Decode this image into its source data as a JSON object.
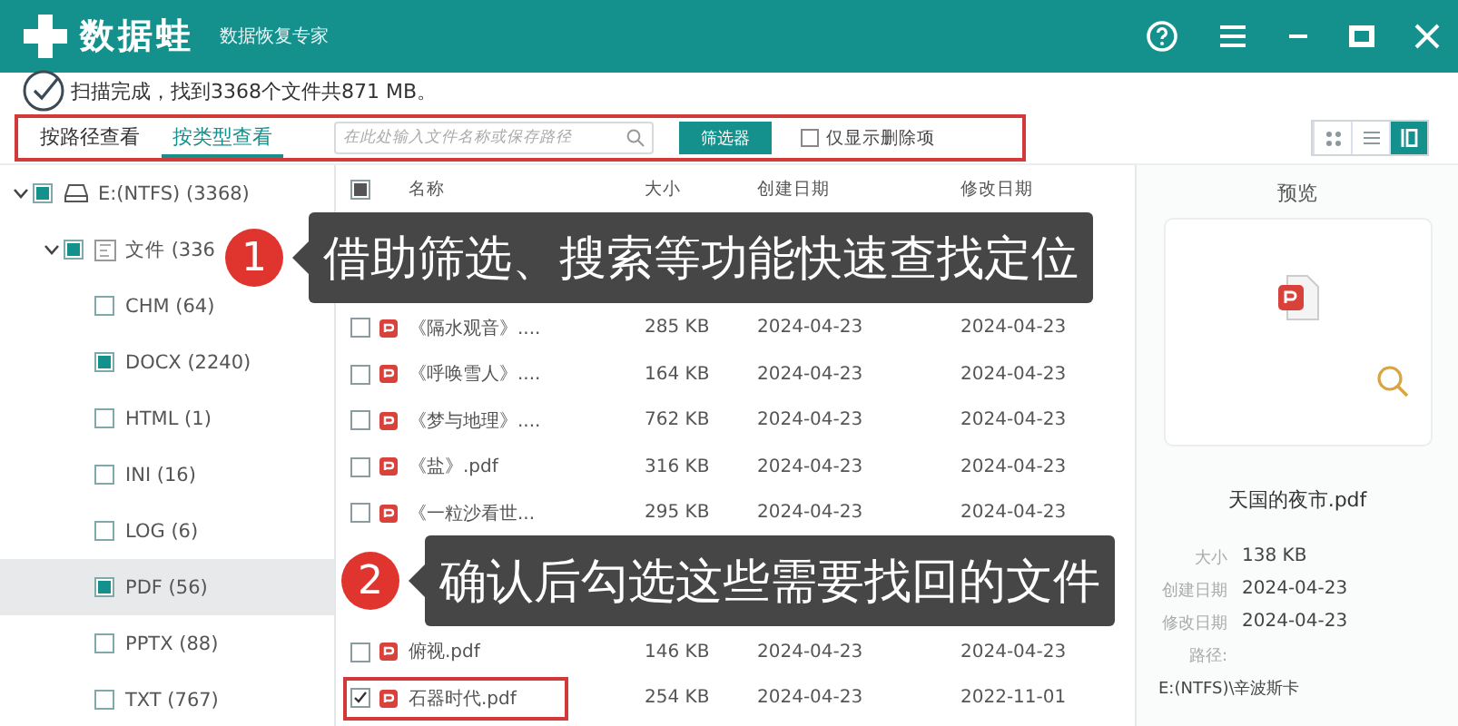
{
  "window": {
    "title": "数据蛙",
    "subtitle": "数据恢复专家"
  },
  "status": {
    "text": "扫描完成，找到3368个文件共871 MB。"
  },
  "toolbar": {
    "highlighted": true,
    "tabs": [
      {
        "label": "按路径查看",
        "selected": false
      },
      {
        "label": "按类型查看",
        "selected": true
      }
    ],
    "search": {
      "placeholder": "在此处输入文件名称或保存路径"
    },
    "filter_button": "筛选器",
    "deleted_only": {
      "label": "仅显示删除项",
      "checked": false
    },
    "views": [
      {
        "kind": "grid",
        "selected": false
      },
      {
        "kind": "list",
        "selected": false
      },
      {
        "kind": "detail",
        "selected": true
      }
    ]
  },
  "tree": {
    "items": [
      {
        "label": "E:(NTFS) (3368)",
        "kind": "drive",
        "checked": true,
        "selected": false,
        "expanded": true,
        "children": [
          {
            "label": "文件 (336",
            "kind": "folder",
            "checked": true,
            "selected": false,
            "expanded": true,
            "children": [
              {
                "label": "CHM (64)",
                "checked": false,
                "selected": false
              },
              {
                "label": "DOCX (2240)",
                "checked": true,
                "selected": false
              },
              {
                "label": "HTML (1)",
                "checked": false,
                "selected": false
              },
              {
                "label": "INI (16)",
                "checked": false,
                "selected": false
              },
              {
                "label": "LOG (6)",
                "checked": false,
                "selected": false
              },
              {
                "label": "PDF (56)",
                "checked": true,
                "selected": true
              },
              {
                "label": "PPTX (88)",
                "checked": false,
                "selected": false
              },
              {
                "label": "TXT (767)",
                "checked": false,
                "selected": false
              }
            ]
          }
        ]
      }
    ]
  },
  "table": {
    "select_all_checked": true,
    "columns": [
      "名称",
      "大小",
      "创建日期",
      "修改日期"
    ],
    "rows": [
      {},
      {},
      {
        "name": "《隔水观音》....",
        "size": "285 KB",
        "created": "2024-04-23",
        "modified": "2024-04-23",
        "checked": false,
        "highlighted": false
      },
      {
        "name": "《呼唤雪人》....",
        "size": "164 KB",
        "created": "2024-04-23",
        "modified": "2024-04-23",
        "checked": false,
        "highlighted": false
      },
      {
        "name": "《梦与地理》....",
        "size": "762 KB",
        "created": "2024-04-23",
        "modified": "2024-04-23",
        "checked": false,
        "highlighted": false
      },
      {
        "name": "《盐》.pdf",
        "size": "316 KB",
        "created": "2024-04-23",
        "modified": "2024-04-23",
        "checked": false,
        "highlighted": false
      },
      {
        "name": "《一粒沙看世...",
        "size": "295 KB",
        "created": "2024-04-23",
        "modified": "2024-04-23",
        "checked": false,
        "highlighted": false
      },
      {},
      {},
      {
        "name": "俯视.pdf",
        "size": "146 KB",
        "created": "2024-04-23",
        "modified": "2024-04-23",
        "checked": false,
        "highlighted": false
      },
      {
        "name": "石器时代.pdf",
        "size": "254 KB",
        "created": "2024-04-23",
        "modified": "2022-11-01",
        "checked": true,
        "highlighted": true
      }
    ]
  },
  "preview": {
    "title": "预览",
    "file_name": "天国的夜市.pdf",
    "details": [
      {
        "label": "大小",
        "value": "138 KB",
        "kind": "inline"
      },
      {
        "label": "创建日期",
        "value": "2024-04-23",
        "kind": "inline"
      },
      {
        "label": "修改日期",
        "value": "2024-04-23",
        "kind": "inline"
      },
      {
        "label": "路径:",
        "value": "E:(NTFS)\\辛波斯卡",
        "kind": "block"
      }
    ]
  },
  "callouts": [
    {
      "number": "1",
      "text": "借助筛选、搜索等功能快速查找定位"
    },
    {
      "number": "2",
      "text": "确认后勾选这些需要找回的文件"
    }
  ]
}
